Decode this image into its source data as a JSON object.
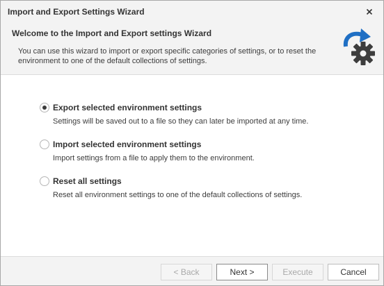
{
  "window": {
    "title": "Import and Export Settings Wizard"
  },
  "header": {
    "title": "Welcome to the Import and Export settings Wizard",
    "description": "You can use this wizard to import or export specific categories of settings, or to reset the environment to one of the default collections of settings.",
    "icon": "refresh-gear-icon",
    "icon_colors": {
      "arrow": "#1f6fc4",
      "gear": "#3d3d3d"
    }
  },
  "options": [
    {
      "label": "Export selected environment settings",
      "description": "Settings will be saved out to a file so they can later be imported at any time.",
      "selected": true
    },
    {
      "label": "Import selected environment settings",
      "description": "Import settings from a file to apply them to the environment.",
      "selected": false
    },
    {
      "label": "Reset all settings",
      "description": "Reset all environment settings to one of the default collections of settings.",
      "selected": false
    }
  ],
  "buttons": {
    "back": "< Back",
    "next": "Next >",
    "execute": "Execute",
    "cancel": "Cancel"
  }
}
